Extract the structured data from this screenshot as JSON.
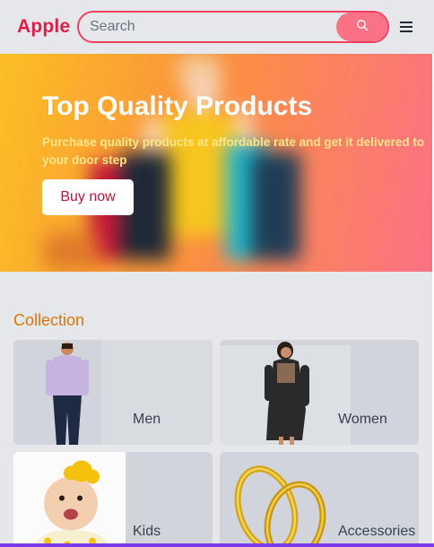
{
  "header": {
    "brand": "Apple",
    "search_placeholder": "Search",
    "search_value": ""
  },
  "hero": {
    "title": "Top Quality Products",
    "subtitle": "Purchase quality products at affordable rate and get it delivered to your door step",
    "button_label": "Buy now"
  },
  "collection": {
    "title": "Collection",
    "items": [
      {
        "label": "Men"
      },
      {
        "label": "Women"
      },
      {
        "label": "Kids"
      },
      {
        "label": "Accessories"
      }
    ]
  },
  "colors": {
    "brand": "#e11d48",
    "accent": "#fb7185",
    "section_title": "#d97706",
    "hero_gradient_start": "#fbbf24",
    "hero_gradient_end": "#fb7185"
  },
  "icons": {
    "search": "search-icon",
    "menu": "hamburger-menu-icon"
  }
}
